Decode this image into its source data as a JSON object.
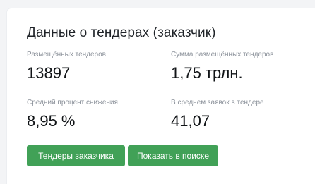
{
  "card": {
    "title": "Данные о тендерах (заказчик)"
  },
  "stats": {
    "tenders_posted": {
      "label": "Размещённых тендеров",
      "value": "13897"
    },
    "tenders_sum": {
      "label": "Сумма размещённых тендеров",
      "value": "1,75 трлн."
    },
    "avg_reduction": {
      "label": "Средний процент снижения",
      "value": "8,95 %"
    },
    "avg_bids": {
      "label": "В среднем заявок в тендере",
      "value": "41,07"
    }
  },
  "buttons": {
    "customer_tenders": "Тендеры заказчика",
    "show_in_search": "Показать в поиске"
  },
  "colors": {
    "button_green": "#41a157",
    "label_gray": "#8a9099"
  }
}
